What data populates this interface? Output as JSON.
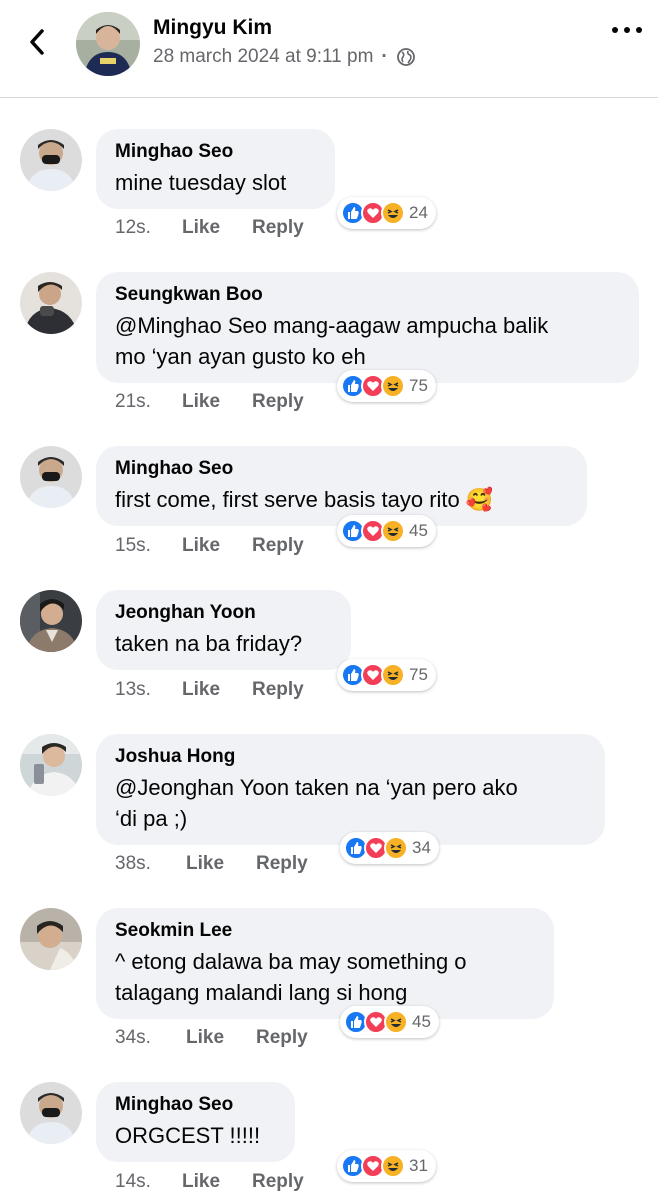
{
  "header": {
    "name": "Mingyu Kim",
    "timestamp": "28 march 2024 at 9:11 pm",
    "separator": "·",
    "privacy_icon": "globe-icon",
    "back_icon": "chevron-left-icon",
    "more_icon": "more-dots-icon"
  },
  "action_labels": {
    "like": "Like",
    "reply": "Reply"
  },
  "reaction_icons": [
    "like-icon",
    "love-icon",
    "haha-icon"
  ],
  "colors": {
    "like": "#1877f2",
    "love": "#f33e58",
    "haha": "#f7b125",
    "bubble": "#f0f2f5",
    "muted": "#65676b"
  },
  "comments": [
    {
      "author": "Minghao Seo",
      "text": [
        "mine tuesday slot"
      ],
      "time": "12s.",
      "reactions": "24"
    },
    {
      "author": "Seungkwan Boo",
      "text": [
        "@Minghao Seo mang-aagaw ampucha balik",
        "mo ‘yan ayan gusto ko eh"
      ],
      "time": "21s.",
      "reactions": "75"
    },
    {
      "author": "Minghao Seo",
      "text": [
        "first come, first serve basis tayo rito 🥰"
      ],
      "time": "15s.",
      "reactions": "45"
    },
    {
      "author": "Jeonghan Yoon",
      "text": [
        "taken na ba friday?"
      ],
      "time": "13s.",
      "reactions": "75"
    },
    {
      "author": "Joshua Hong",
      "text": [
        "@Jeonghan Yoon taken na ‘yan pero ako",
        "‘di pa ;)"
      ],
      "time": "38s.",
      "reactions": "34"
    },
    {
      "author": "Seokmin Lee",
      "text": [
        "^ etong dalawa ba may something o",
        "talagang malandi lang si hong"
      ],
      "time": "34s.",
      "reactions": "45"
    },
    {
      "author": "Minghao Seo",
      "text": [
        "ORGCEST !!!!!"
      ],
      "time": "14s.",
      "reactions": "31"
    }
  ]
}
